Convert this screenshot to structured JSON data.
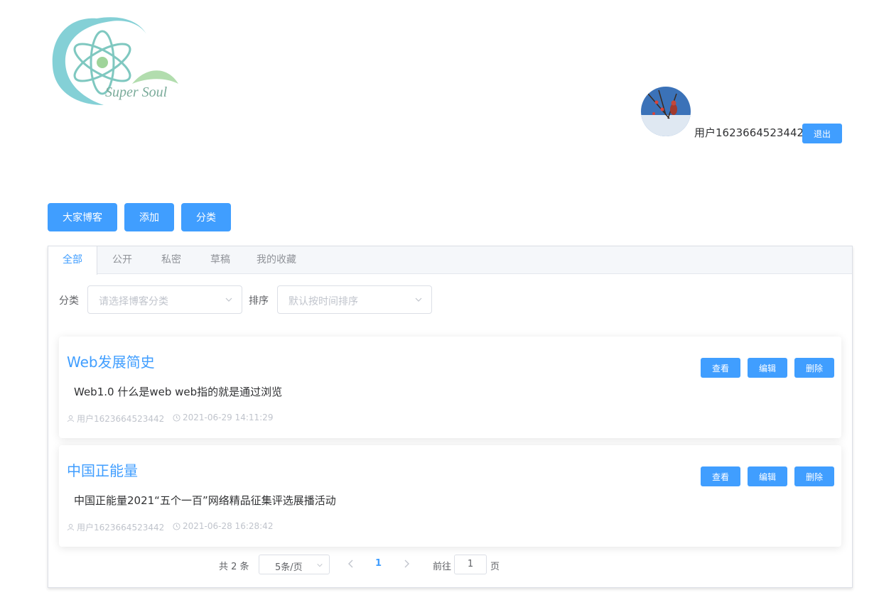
{
  "header": {
    "logo_text": "Super Soul",
    "username": "用户1623664523442",
    "logout_label": "退出"
  },
  "toolbar": {
    "buttons": [
      "大家博客",
      "添加",
      "分类"
    ]
  },
  "tabs": [
    "全部",
    "公开",
    "私密",
    "草稿",
    "我的收藏"
  ],
  "active_tab": "全部",
  "filters": {
    "category_label": "分类",
    "category_placeholder": "请选择博客分类",
    "sort_label": "排序",
    "sort_placeholder": "默认按时间排序"
  },
  "posts": [
    {
      "title": "Web发展简史",
      "summary": "Web1.0 什么是web web指的就是通过浏览",
      "author": "用户1623664523442",
      "time": "2021-06-29 14:11:29",
      "view_label": "查看",
      "edit_label": "编辑",
      "delete_label": "删除"
    },
    {
      "title": "中国正能量",
      "summary": "中国正能量2021“五个一百”网络精品征集评选展播活动",
      "author": "用户1623664523442",
      "time": "2021-06-28 16:28:42",
      "view_label": "查看",
      "edit_label": "编辑",
      "delete_label": "删除"
    }
  ],
  "pagination": {
    "total": "共 2 条",
    "page_size": "5条/页",
    "current_page": "1",
    "goto_label": "前往",
    "goto_value": "1",
    "page_unit": "页"
  },
  "colors": {
    "primary": "#409eff",
    "logo_teal": "#5bc0c8",
    "logo_green": "#9fd49a"
  }
}
